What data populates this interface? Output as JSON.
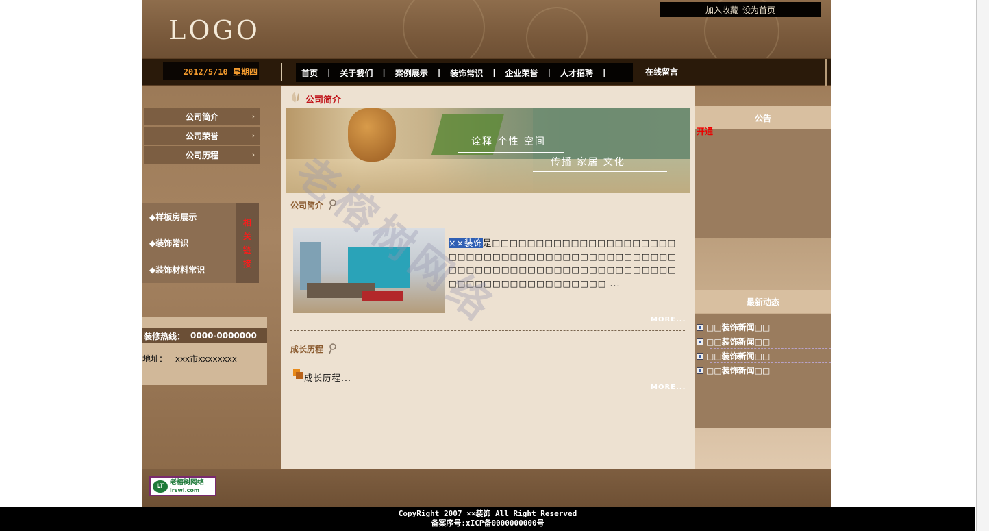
{
  "header": {
    "logo": "LOGO",
    "links": [
      "加入收藏",
      "设为首页"
    ]
  },
  "nav": {
    "date": "2012/5/10 星期四",
    "items": [
      "首页",
      "关于我们",
      "案例展示",
      "装饰常识",
      "企业荣誉",
      "人才招聘"
    ],
    "last_item": "在线留言"
  },
  "left": {
    "menu": [
      "公司简介",
      "公司荣誉",
      "公司历程"
    ],
    "links": [
      "◆样板房展示",
      "◆装饰常识",
      "◆装饰材料常识"
    ],
    "links_side": [
      "相",
      "关",
      "链",
      "接"
    ],
    "hotline_label": "装修热线：",
    "hotline_number": "0000-0000000",
    "address_label": "地址：",
    "address_value": "xxx市xxxxxxxx"
  },
  "center": {
    "section_title": "公司简介",
    "banner_line1": "诠释 个性 空间",
    "banner_line2": "传播 家居 文化",
    "intro_title": "公司简介",
    "intro_highlight": "××装饰",
    "intro_text": "是□□□□□□□□□□□□□□□□□□□□□□□□□□□□□□□□□□□□□□□□□□□□□□□□□□□□□□□□□□□□□□□□□□□□□□□□□□□□□□□□□□□□□□□□□□□ ...",
    "more": "MORE...",
    "history_title": "成长历程",
    "history_text": "成长历程...",
    "watermark": "老榕树网络"
  },
  "right": {
    "notice_title": "公告",
    "notice_cut": "开通",
    "news_title": "最新动态",
    "news": [
      "□□装饰新闻□□",
      "□□装饰新闻□□",
      "□□装饰新闻□□",
      "□□装饰新闻□□"
    ]
  },
  "footer": {
    "logo_text": "老榕树网络",
    "logo_sub": "lrswl.com",
    "copyright": "CopyRight 2007 ××装饰 All Right Reserved",
    "icp": "备案序号:xICP备0000000000号"
  },
  "colors": {
    "accent_red": "#c0141a",
    "date_orange": "#f29a2e",
    "content_bg": "#ede1d1"
  }
}
